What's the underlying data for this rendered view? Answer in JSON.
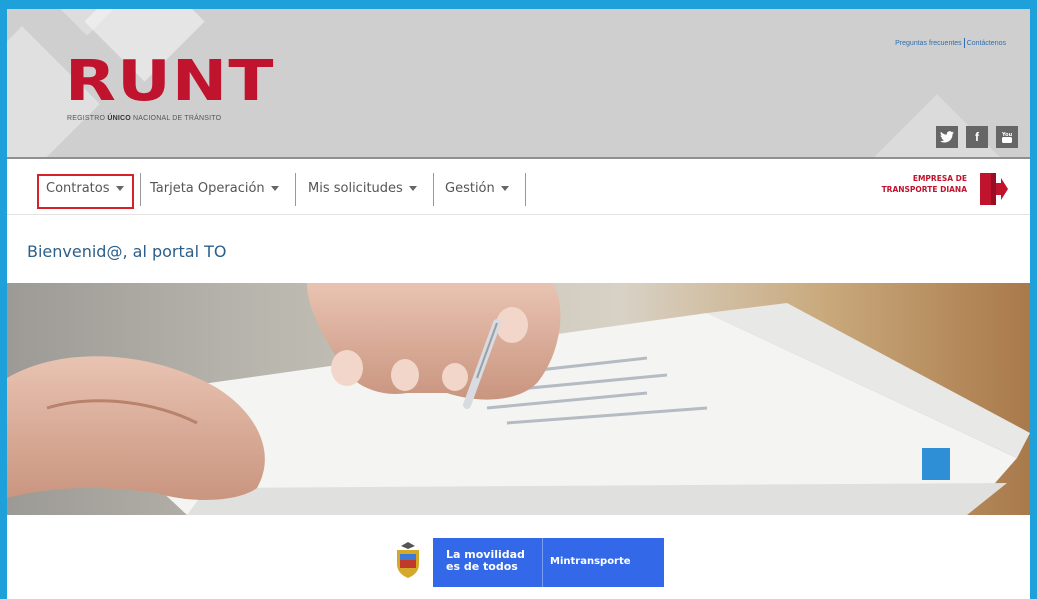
{
  "header": {
    "logo_text": "RUNT",
    "logo_sub_prefix": "REGISTRO ",
    "logo_sub_bold": "ÚNICO",
    "logo_sub_suffix": " NACIONAL DE TRÁNSITO",
    "links": [
      "Preguntas frecuentes",
      "Contáctenos"
    ],
    "social": [
      {
        "icon": "twitter-icon",
        "glyph": "🐦"
      },
      {
        "icon": "facebook-icon",
        "glyph": "f"
      },
      {
        "icon": "youtube-icon",
        "glyph": "▶"
      }
    ]
  },
  "nav": {
    "items": [
      "Contratos",
      "Tarjeta Operación",
      "Mis solicitudes",
      "Gestión"
    ],
    "company_line1": "EMPRESA DE",
    "company_line2": "TRANSPORTE DIANA",
    "exit_icon": "logout-door-icon"
  },
  "main": {
    "welcome": "Bienvenid@, al portal TO"
  },
  "footer": {
    "slogan_line1": "La movilidad",
    "slogan_line2": "es de todos",
    "ministry": "Mintransporte"
  },
  "colors": {
    "frame": "#1ea0db",
    "brand_red": "#c0132d",
    "highlight": "#d6202c",
    "welcome_text": "#2b5f8a",
    "footer_blue": "#3369e8"
  }
}
